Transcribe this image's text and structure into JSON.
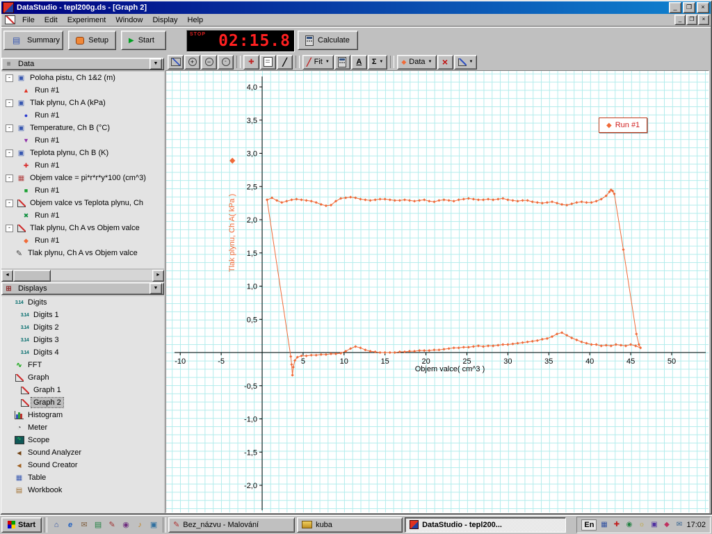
{
  "window": {
    "title": "DataStudio - tepl200g.ds - [Graph 2]"
  },
  "menu": {
    "items": [
      "File",
      "Edit",
      "Experiment",
      "Window",
      "Display",
      "Help"
    ]
  },
  "toolbar": {
    "summary_label": "Summary",
    "setup_label": "Setup",
    "start_label": "Start",
    "timer_stop_label": "STOP",
    "timer_value": "02:15.8",
    "calculate_label": "Calculate"
  },
  "graph_toolbar": {
    "fit_label": "Fit",
    "data_label": "Data",
    "icons": [
      "scale-to-fit",
      "zoom-in",
      "zoom-out",
      "zoom-select",
      "smart-tool",
      "note-tool",
      "slope-tool",
      "fit-menu",
      "calculator",
      "text-tool",
      "statistics-menu",
      "data-menu",
      "delete",
      "graph-settings-menu"
    ]
  },
  "data_panel": {
    "header": "Data",
    "items": [
      {
        "label": "Poloha pistu, Ch 1&2 (m)",
        "run_label": "Run #1",
        "icon": "sensor-icon",
        "marker": "triangle-up-red"
      },
      {
        "label": "Tlak plynu, Ch A (kPa)",
        "run_label": "Run #1",
        "icon": "sensor-icon",
        "marker": "circle-blue"
      },
      {
        "label": "Temperature, Ch B (°C)",
        "run_label": "Run #1",
        "icon": "sensor-icon",
        "marker": "triangle-down-purple"
      },
      {
        "label": "Teplota plynu, Ch B (K)",
        "run_label": "Run #1",
        "icon": "sensor-icon",
        "marker": "plus-red"
      },
      {
        "label": "Objem valce = pi*r*r*y*100 (cm^3)",
        "run_label": "Run #1",
        "icon": "calculator-icon",
        "marker": "square-green"
      },
      {
        "label": "Objem valce vs Teplota plynu, Ch",
        "run_label": "Run #1",
        "icon": "xy-data-icon",
        "marker": "x-green"
      },
      {
        "label": "Tlak plynu, Ch A vs Objem valce",
        "run_label": "Run #1",
        "icon": "xy-data-icon",
        "marker": "diamond-orange"
      },
      {
        "label": "Tlak plynu, Ch A vs Objem valce",
        "icon": "pen-icon"
      }
    ]
  },
  "displays_panel": {
    "header": "Displays",
    "items": [
      {
        "label": "Digits",
        "icon": "digits-icon",
        "indent": 0
      },
      {
        "label": "Digits 1",
        "icon": "digits-icon",
        "indent": 1
      },
      {
        "label": "Digits 2",
        "icon": "digits-icon",
        "indent": 1
      },
      {
        "label": "Digits 3",
        "icon": "digits-icon",
        "indent": 1
      },
      {
        "label": "Digits 4",
        "icon": "digits-icon",
        "indent": 1
      },
      {
        "label": "FFT",
        "icon": "fft-icon",
        "indent": 0
      },
      {
        "label": "Graph",
        "icon": "graph-icon",
        "indent": 0
      },
      {
        "label": "Graph 1",
        "icon": "graph-icon",
        "indent": 1
      },
      {
        "label": "Graph 2",
        "icon": "graph-icon",
        "indent": 1,
        "selected": true
      },
      {
        "label": "Histogram",
        "icon": "histogram-icon",
        "indent": 0
      },
      {
        "label": "Meter",
        "icon": "meter-icon",
        "indent": 0
      },
      {
        "label": "Scope",
        "icon": "scope-icon",
        "indent": 0
      },
      {
        "label": "Sound Analyzer",
        "icon": "sound-icon",
        "indent": 0
      },
      {
        "label": "Sound Creator",
        "icon": "sound-icon",
        "indent": 0
      },
      {
        "label": "Table",
        "icon": "table-icon",
        "indent": 0
      },
      {
        "label": "Workbook",
        "icon": "workbook-icon",
        "indent": 0
      }
    ]
  },
  "chart_data": {
    "type": "scatter",
    "title": "",
    "xlabel": "Objem valce( cm^3 )",
    "ylabel": "Tlak plynu, Ch A( kPa )",
    "xlim": [
      -11.8,
      54.8
    ],
    "ylim": [
      -2.45,
      4.25
    ],
    "grid": true,
    "x_tick_values": [
      -10,
      -5,
      5,
      10,
      15,
      20,
      25,
      30,
      35,
      40,
      45,
      50
    ],
    "x_tick_labels": [
      "-10",
      "-5",
      "5",
      "10",
      "15",
      "20",
      "25",
      "30",
      "35",
      "40",
      "45",
      "50"
    ],
    "y_tick_values": [
      4,
      3.5,
      3,
      2.5,
      2,
      1.5,
      1,
      0.5,
      -0.5,
      -1,
      -1.5,
      -2
    ],
    "y_tick_labels": [
      "4,0",
      "3,5",
      "3,0",
      "2,5",
      "2,0",
      "1,5",
      "1,0",
      "0,5",
      "-0,5",
      "-1,0",
      "-1,5",
      "-2,0"
    ],
    "legend": {
      "label": "Run #1",
      "position": "top-right"
    },
    "series": [
      {
        "name": "Run #1",
        "color": "#f06a38",
        "marker": "diamond",
        "points": [
          [
            0.6,
            2.3
          ],
          [
            1.2,
            2.33
          ],
          [
            1.8,
            2.29
          ],
          [
            2.4,
            2.26
          ],
          [
            3.0,
            2.28
          ],
          [
            3.6,
            2.3
          ],
          [
            4.2,
            2.31
          ],
          [
            4.8,
            2.3
          ],
          [
            5.4,
            2.29
          ],
          [
            6.0,
            2.28
          ],
          [
            6.6,
            2.26
          ],
          [
            7.2,
            2.23
          ],
          [
            7.8,
            2.21
          ],
          [
            8.4,
            2.22
          ],
          [
            9.0,
            2.28
          ],
          [
            9.6,
            2.32
          ],
          [
            10.2,
            2.33
          ],
          [
            10.8,
            2.34
          ],
          [
            11.4,
            2.33
          ],
          [
            12.0,
            2.31
          ],
          [
            12.6,
            2.3
          ],
          [
            13.2,
            2.29
          ],
          [
            13.8,
            2.3
          ],
          [
            14.4,
            2.31
          ],
          [
            15.0,
            2.31
          ],
          [
            15.6,
            2.3
          ],
          [
            16.2,
            2.29
          ],
          [
            16.8,
            2.29
          ],
          [
            17.4,
            2.3
          ],
          [
            18.0,
            2.29
          ],
          [
            18.6,
            2.28
          ],
          [
            19.2,
            2.29
          ],
          [
            19.8,
            2.3
          ],
          [
            20.4,
            2.28
          ],
          [
            21.0,
            2.27
          ],
          [
            21.6,
            2.29
          ],
          [
            22.2,
            2.3
          ],
          [
            22.8,
            2.29
          ],
          [
            23.4,
            2.28
          ],
          [
            24.0,
            2.3
          ],
          [
            24.6,
            2.31
          ],
          [
            25.2,
            2.32
          ],
          [
            25.8,
            2.31
          ],
          [
            26.4,
            2.3
          ],
          [
            27.0,
            2.3
          ],
          [
            27.6,
            2.31
          ],
          [
            28.2,
            2.3
          ],
          [
            28.8,
            2.31
          ],
          [
            29.4,
            2.32
          ],
          [
            30.0,
            2.3
          ],
          [
            30.6,
            2.29
          ],
          [
            31.2,
            2.28
          ],
          [
            31.8,
            2.29
          ],
          [
            32.4,
            2.29
          ],
          [
            33.0,
            2.27
          ],
          [
            33.6,
            2.26
          ],
          [
            34.2,
            2.25
          ],
          [
            34.8,
            2.26
          ],
          [
            35.4,
            2.27
          ],
          [
            36.0,
            2.25
          ],
          [
            36.6,
            2.23
          ],
          [
            37.2,
            2.22
          ],
          [
            37.8,
            2.24
          ],
          [
            38.4,
            2.26
          ],
          [
            39.0,
            2.27
          ],
          [
            39.6,
            2.26
          ],
          [
            40.2,
            2.26
          ],
          [
            40.8,
            2.28
          ],
          [
            41.4,
            2.31
          ],
          [
            42.0,
            2.36
          ],
          [
            42.4,
            2.42
          ],
          [
            42.6,
            2.45
          ],
          [
            42.8,
            2.43
          ],
          [
            43.0,
            2.39
          ],
          [
            44.1,
            1.55
          ],
          [
            45.7,
            0.28
          ],
          [
            46.0,
            0.12
          ],
          [
            46.2,
            0.07
          ],
          [
            45.6,
            0.1
          ],
          [
            45.0,
            0.12
          ],
          [
            44.4,
            0.1
          ],
          [
            43.8,
            0.11
          ],
          [
            43.2,
            0.12
          ],
          [
            42.6,
            0.1
          ],
          [
            42.0,
            0.11
          ],
          [
            41.4,
            0.1
          ],
          [
            40.8,
            0.12
          ],
          [
            40.2,
            0.12
          ],
          [
            39.6,
            0.14
          ],
          [
            39.0,
            0.16
          ],
          [
            38.4,
            0.19
          ],
          [
            37.8,
            0.22
          ],
          [
            37.2,
            0.26
          ],
          [
            36.6,
            0.3
          ],
          [
            36.0,
            0.28
          ],
          [
            35.4,
            0.24
          ],
          [
            34.8,
            0.21
          ],
          [
            34.2,
            0.2
          ],
          [
            33.6,
            0.18
          ],
          [
            33.0,
            0.17
          ],
          [
            32.4,
            0.16
          ],
          [
            31.8,
            0.15
          ],
          [
            31.2,
            0.14
          ],
          [
            30.6,
            0.13
          ],
          [
            30.0,
            0.12
          ],
          [
            29.4,
            0.12
          ],
          [
            28.8,
            0.11
          ],
          [
            28.2,
            0.1
          ],
          [
            27.6,
            0.1
          ],
          [
            27.0,
            0.09
          ],
          [
            26.4,
            0.1
          ],
          [
            25.8,
            0.09
          ],
          [
            25.2,
            0.08
          ],
          [
            24.6,
            0.08
          ],
          [
            24.0,
            0.07
          ],
          [
            23.4,
            0.07
          ],
          [
            22.8,
            0.06
          ],
          [
            22.2,
            0.05
          ],
          [
            21.6,
            0.04
          ],
          [
            21.0,
            0.04
          ],
          [
            20.4,
            0.03
          ],
          [
            19.8,
            0.03
          ],
          [
            19.2,
            0.03
          ],
          [
            18.6,
            0.02
          ],
          [
            18.0,
            0.02
          ],
          [
            17.4,
            0.01
          ],
          [
            16.8,
            0.01
          ],
          [
            16.2,
            0.0
          ],
          [
            15.6,
            0.0
          ],
          [
            15.0,
            0.0
          ],
          [
            14.4,
            0.0
          ],
          [
            13.8,
            0.01
          ],
          [
            13.2,
            0.02
          ],
          [
            12.6,
            0.04
          ],
          [
            12.0,
            0.07
          ],
          [
            11.4,
            0.09
          ],
          [
            10.8,
            0.06
          ],
          [
            10.2,
            0.02
          ],
          [
            9.6,
            -0.01
          ],
          [
            9.0,
            -0.02
          ],
          [
            8.4,
            -0.02
          ],
          [
            7.8,
            -0.03
          ],
          [
            7.2,
            -0.03
          ],
          [
            6.6,
            -0.04
          ],
          [
            6.0,
            -0.04
          ],
          [
            5.4,
            -0.05
          ],
          [
            4.8,
            -0.05
          ],
          [
            4.3,
            -0.07
          ],
          [
            4.0,
            -0.12
          ],
          [
            3.8,
            -0.22
          ],
          [
            3.7,
            -0.34
          ],
          [
            3.6,
            -0.18
          ],
          [
            3.5,
            -0.06
          ],
          [
            0.6,
            2.3
          ]
        ]
      }
    ]
  },
  "taskbar": {
    "start_label": "Start",
    "tasks": [
      {
        "label": "Bez_názvu - Malování",
        "icon": "paint-icon",
        "active": false
      },
      {
        "label": "kuba",
        "icon": "folder-icon",
        "active": false
      },
      {
        "label": "DataStudio - tepl200...",
        "icon": "datastudio-icon",
        "active": true
      }
    ],
    "tray": {
      "lang": "En",
      "clock": "17:02"
    }
  },
  "colors": {
    "accent_orange": "#f06a38",
    "titlebar_blue": "#000080",
    "grid_cyan": "#b2ecec",
    "legend_red": "#d02020",
    "window_gray": "#c0c0c0"
  }
}
